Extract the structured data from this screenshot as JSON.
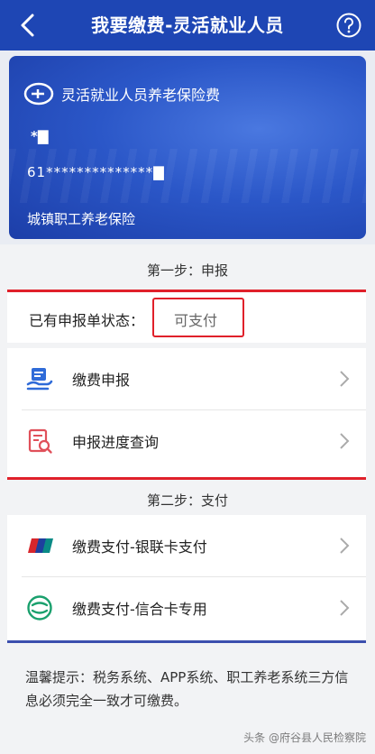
{
  "header": {
    "title": "我要缴费-灵活就业人员"
  },
  "card": {
    "title": "灵活就业人员养老保险费",
    "name_masked": "*▇",
    "id_masked": "61**************▇",
    "insurance_type": "城镇职工养老保险"
  },
  "step1": {
    "label": "第一步：申报",
    "status_label": "已有申报单状态：",
    "status_value": "可支付",
    "items": [
      {
        "label": "缴费申报",
        "icon": "declaration-icon"
      },
      {
        "label": "申报进度查询",
        "icon": "progress-query-icon"
      }
    ]
  },
  "step2": {
    "label": "第二步：支付",
    "items": [
      {
        "label": "缴费支付-银联卡支付",
        "icon": "unionpay-icon"
      },
      {
        "label": "缴费支付-信合卡专用",
        "icon": "xinhe-card-icon"
      }
    ]
  },
  "tip": {
    "text": "温馨提示：税务系统、APP系统、职工养老系统三方信息必须完全一致才可缴费。"
  },
  "watermark": {
    "text": "头条 @府谷县人民检察院"
  },
  "colors": {
    "header_bg": "#1e46b4",
    "highlight_red": "#e0202a"
  }
}
